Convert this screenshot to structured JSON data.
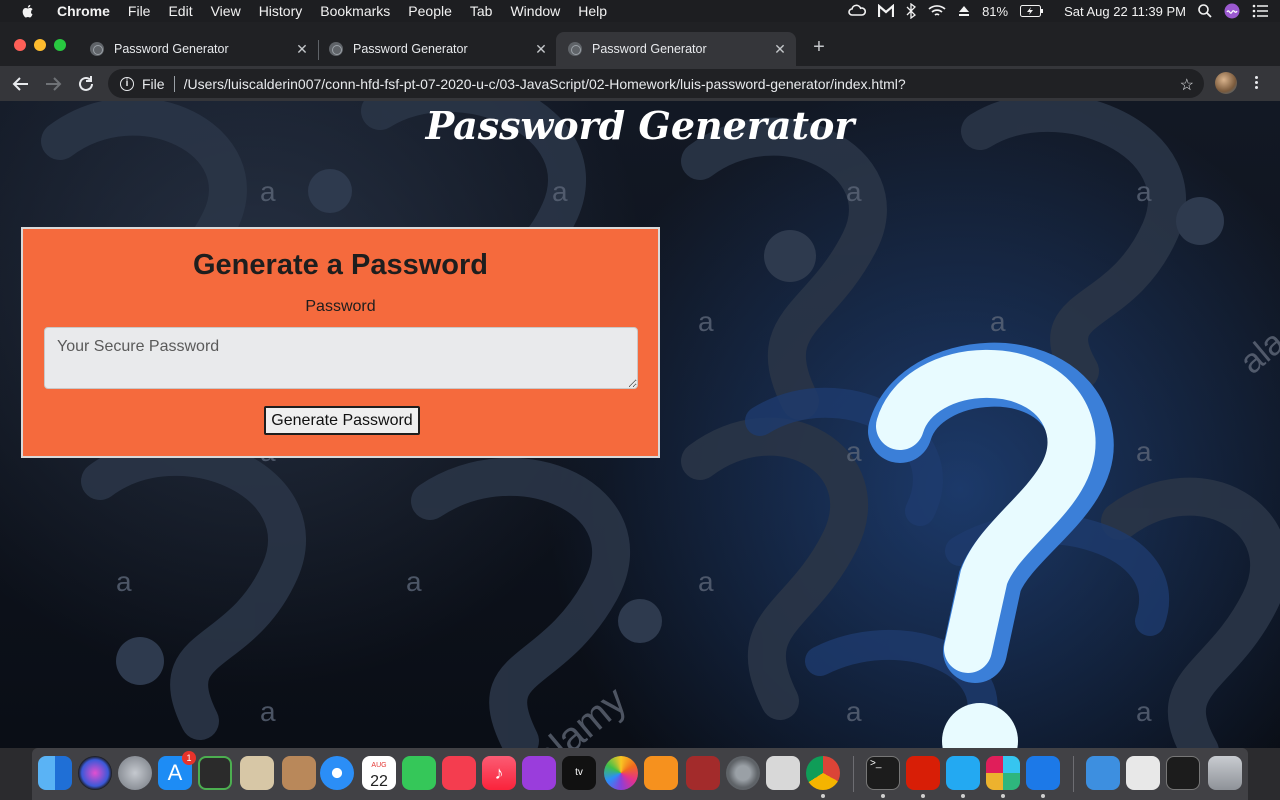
{
  "menubar": {
    "app_name": "Chrome",
    "items": [
      "File",
      "Edit",
      "View",
      "History",
      "Bookmarks",
      "People",
      "Tab",
      "Window",
      "Help"
    ],
    "battery": "81%",
    "clock": "Sat Aug 22  11:39 PM"
  },
  "tabs": [
    {
      "title": "Password Generator",
      "active": false
    },
    {
      "title": "Password Generator",
      "active": false
    },
    {
      "title": "Password Generator",
      "active": true
    }
  ],
  "omnibox": {
    "scheme_label": "File",
    "url": "/Users/luiscalderin007/conn-hfd-fsf-pt-07-2020-u-c/03-JavaScript/02-Homework/luis-password-generator/index.html?"
  },
  "page": {
    "heading": "Password Generator",
    "card_title": "Generate a Password",
    "field_label": "Password",
    "password_placeholder": "Your Secure Password",
    "password_value": "",
    "button_label": "Generate Password",
    "card_color": "#f56a3d"
  },
  "dock": {
    "calendar_month": "AUG",
    "calendar_day": "22",
    "app_store_badge": "1",
    "apps": [
      "finder",
      "siri",
      "launchpad",
      "app-store",
      "mission-control",
      "mail",
      "contacts",
      "safari",
      "calendar",
      "messages",
      "news",
      "music",
      "podcasts",
      "apple-tv",
      "photos",
      "books",
      "photo-booth",
      "system-preferences",
      "preview",
      "chrome",
      "terminal",
      "acrobat",
      "vscode",
      "slack",
      "xcode",
      "downloads",
      "screenshot",
      "display",
      "trash"
    ]
  }
}
